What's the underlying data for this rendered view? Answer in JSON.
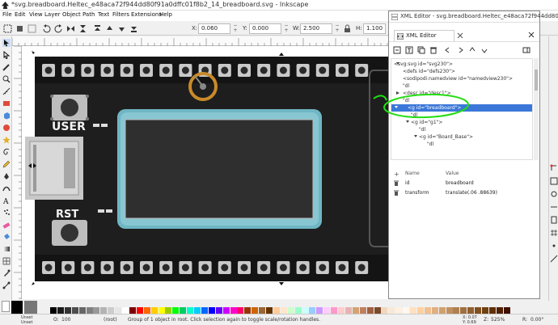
{
  "window": {
    "title": "*svg.breadboard.Heltec_e48aca72f944dd80f91a0dffc01f8b2_14_breadboard.svg - Inkscape"
  },
  "menu": [
    "File",
    "Edit",
    "View",
    "Layer",
    "Object",
    "Path",
    "Text",
    "Filters",
    "Extensions",
    "Help"
  ],
  "commandbar": {
    "x_label": "X:",
    "x_value": "0.060",
    "y_label": "Y:",
    "y_value": "0.000",
    "w_label": "W:",
    "w_value": "2.500",
    "h_label": "H:",
    "h_value": "1.100"
  },
  "board": {
    "user_label": "USER",
    "rst_label": "RST"
  },
  "xml_editor": {
    "window_title": "XML Editor - svg.breadboard.Heltec_e48aca72f944dd80f091...",
    "tab_label": "XML Editor",
    "nodes": [
      {
        "text": "<svg:svg id=\"svg230\">",
        "depth": 0,
        "selected": false
      },
      {
        "text": "<defs id=\"defs230\">",
        "depth": 1,
        "selected": false
      },
      {
        "text": "<sodipodi:namedview id=\"namedview230\">",
        "depth": 1,
        "selected": false
      },
      {
        "text": "\"dl",
        "depth": 1,
        "selected": false
      },
      {
        "text": "<desc id=\"desc1\">",
        "depth": 1,
        "selected": false
      },
      {
        "text": "\"dl",
        "depth": 1,
        "selected": false
      },
      {
        "text": "<g id=\"breadboard\">",
        "depth": 1,
        "selected": true
      },
      {
        "text": "\"dl",
        "depth": 2,
        "selected": false
      },
      {
        "text": "<g id=\"g1\">",
        "depth": 2,
        "selected": false
      },
      {
        "text": "\"dl",
        "depth": 3,
        "selected": false
      },
      {
        "text": "<g id=\"Board_Base\">",
        "depth": 3,
        "selected": false
      },
      {
        "text": "\"dl",
        "depth": 4,
        "selected": false
      }
    ],
    "attr_header": {
      "name": "Name",
      "value": "Value"
    },
    "attributes": [
      {
        "name": "id",
        "value": "breadboard"
      },
      {
        "name": "transform",
        "value": "translate(.06 .88639)"
      }
    ]
  },
  "status": {
    "fill_label": "Unset",
    "stroke_label": "Unset",
    "opacity_label": "O:",
    "opacity_value": "100",
    "layer": "(root)",
    "message": "Group of 1 object in root. Click selection again to toggle scale/rotation handles.",
    "x_coord": "X: 0.07",
    "y_coord": "Y: 0.69",
    "zoom_label": "Z:",
    "zoom_value": "525%",
    "rotation_label": "R:",
    "rotation_value": "0.00°"
  },
  "colors": {
    "board": "#1e1e1e",
    "lcd_frame": "#6fb6c4",
    "selection": "#3b77d8",
    "annotation": "#22dd11"
  }
}
